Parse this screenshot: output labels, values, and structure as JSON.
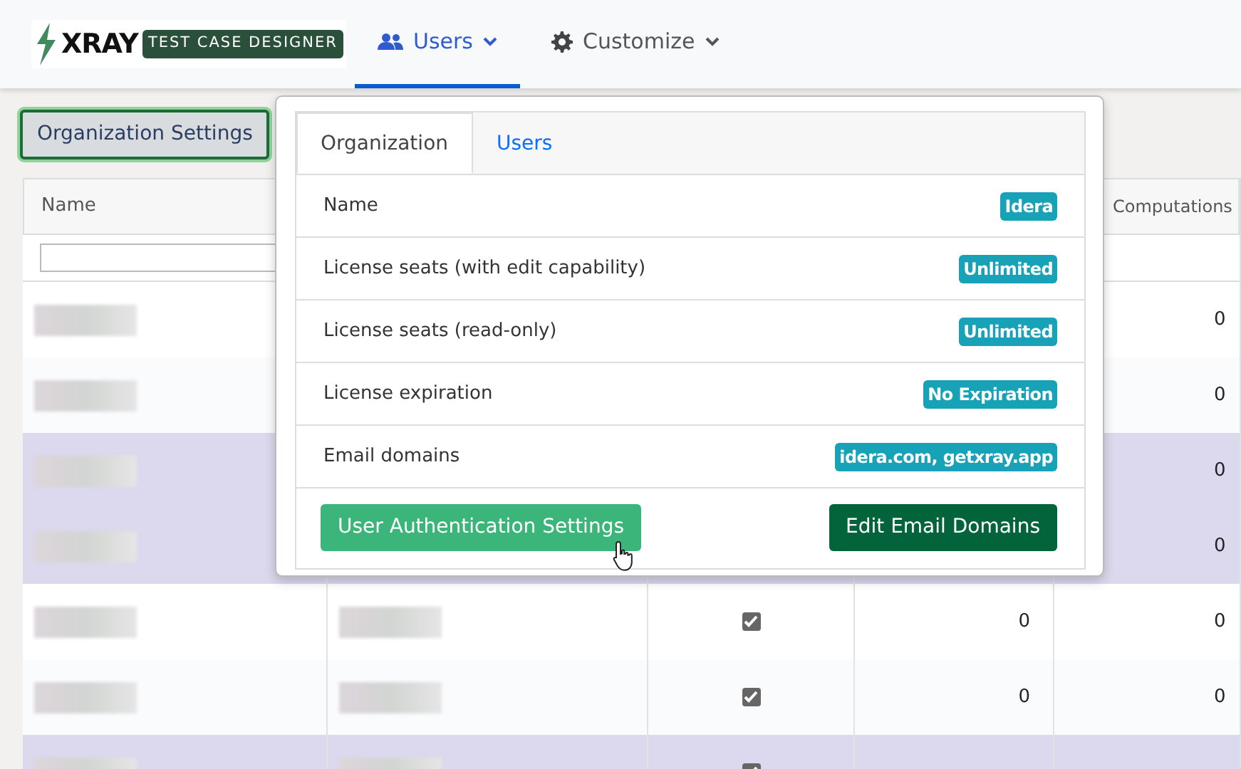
{
  "navbar": {
    "logo": {
      "word": "XRAY",
      "tagline": "TEST CASE DESIGNER"
    },
    "menus": [
      {
        "label": "Users",
        "kind": "users",
        "selected": true
      },
      {
        "label": "Customize",
        "kind": "gear",
        "selected": false
      }
    ]
  },
  "org_button": {
    "label": "Organization Settings"
  },
  "table": {
    "columns": [
      "Name",
      "",
      "",
      "",
      "Computations"
    ],
    "rows": [
      {
        "selected": false,
        "checked": null,
        "column_4": "",
        "column_5": "0"
      },
      {
        "selected": false,
        "checked": null,
        "column_4": "",
        "column_5": "0"
      },
      {
        "selected": true,
        "checked": null,
        "column_4": "",
        "column_5": "0"
      },
      {
        "selected": true,
        "checked": null,
        "column_4": "",
        "column_5": "0"
      },
      {
        "selected": false,
        "checked": true,
        "column_4": "0",
        "column_5": "0"
      },
      {
        "selected": false,
        "checked": true,
        "column_4": "0",
        "column_5": "0"
      },
      {
        "selected": true,
        "checked": true,
        "column_4": "",
        "column_5": ""
      }
    ]
  },
  "popover": {
    "tabs": [
      {
        "label": "Organization",
        "selected": true
      },
      {
        "label": "Users",
        "selected": false
      }
    ],
    "fields": [
      {
        "label": "Name",
        "value": "Idera"
      },
      {
        "label": "License seats (with edit capability)",
        "value": "Unlimited"
      },
      {
        "label": "License seats (read-only)",
        "value": "Unlimited"
      },
      {
        "label": "License expiration",
        "value": "No Expiration"
      },
      {
        "label": "Email domains",
        "value": "idera.com, getxray.app"
      }
    ],
    "buttons": [
      {
        "label": "User Authentication Settings",
        "kind": "light"
      },
      {
        "label": "Edit Email Domains",
        "kind": "dark"
      }
    ]
  }
}
